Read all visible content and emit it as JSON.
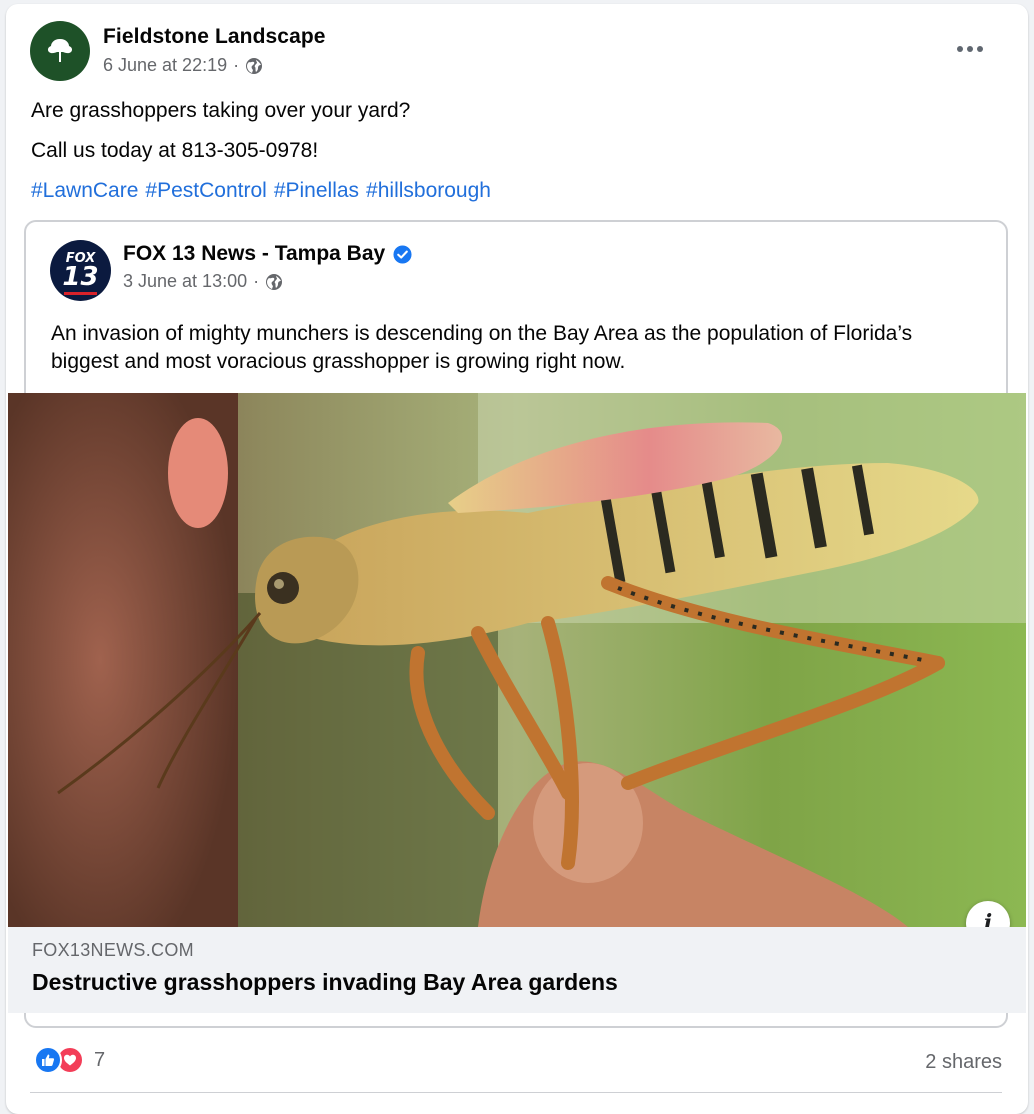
{
  "post": {
    "author": "Fieldstone Landscape",
    "timestamp": "6 June at 22:19",
    "privacy_icon": "globe-icon",
    "line1": "Are grasshoppers taking over your yard?",
    "line2": "Call us today at 813-305-0978!",
    "hashtags": [
      "#LawnCare",
      "#PestControl",
      "#Pinellas",
      "#hillsborough"
    ]
  },
  "shared": {
    "author": "FOX 13 News - Tampa Bay",
    "avatar_text_top": "FOX",
    "avatar_text_num": "13",
    "timestamp": "3 June at 13:00",
    "text": "An invasion of mighty munchers is descending on the Bay Area as the population of Florida’s biggest and most voracious grasshopper is growing right now.",
    "link_domain": "FOX13NEWS.COM",
    "link_title": "Destructive grasshoppers invading Bay Area gardens",
    "info_label": "i"
  },
  "footer": {
    "reaction_count": "7",
    "shares": "2 shares"
  },
  "colors": {
    "hashtag": "#216fdb",
    "avatar_green": "#1e5128",
    "like_blue": "#1877f2",
    "love_red": "#f33e58",
    "muted_text": "#65676b"
  }
}
